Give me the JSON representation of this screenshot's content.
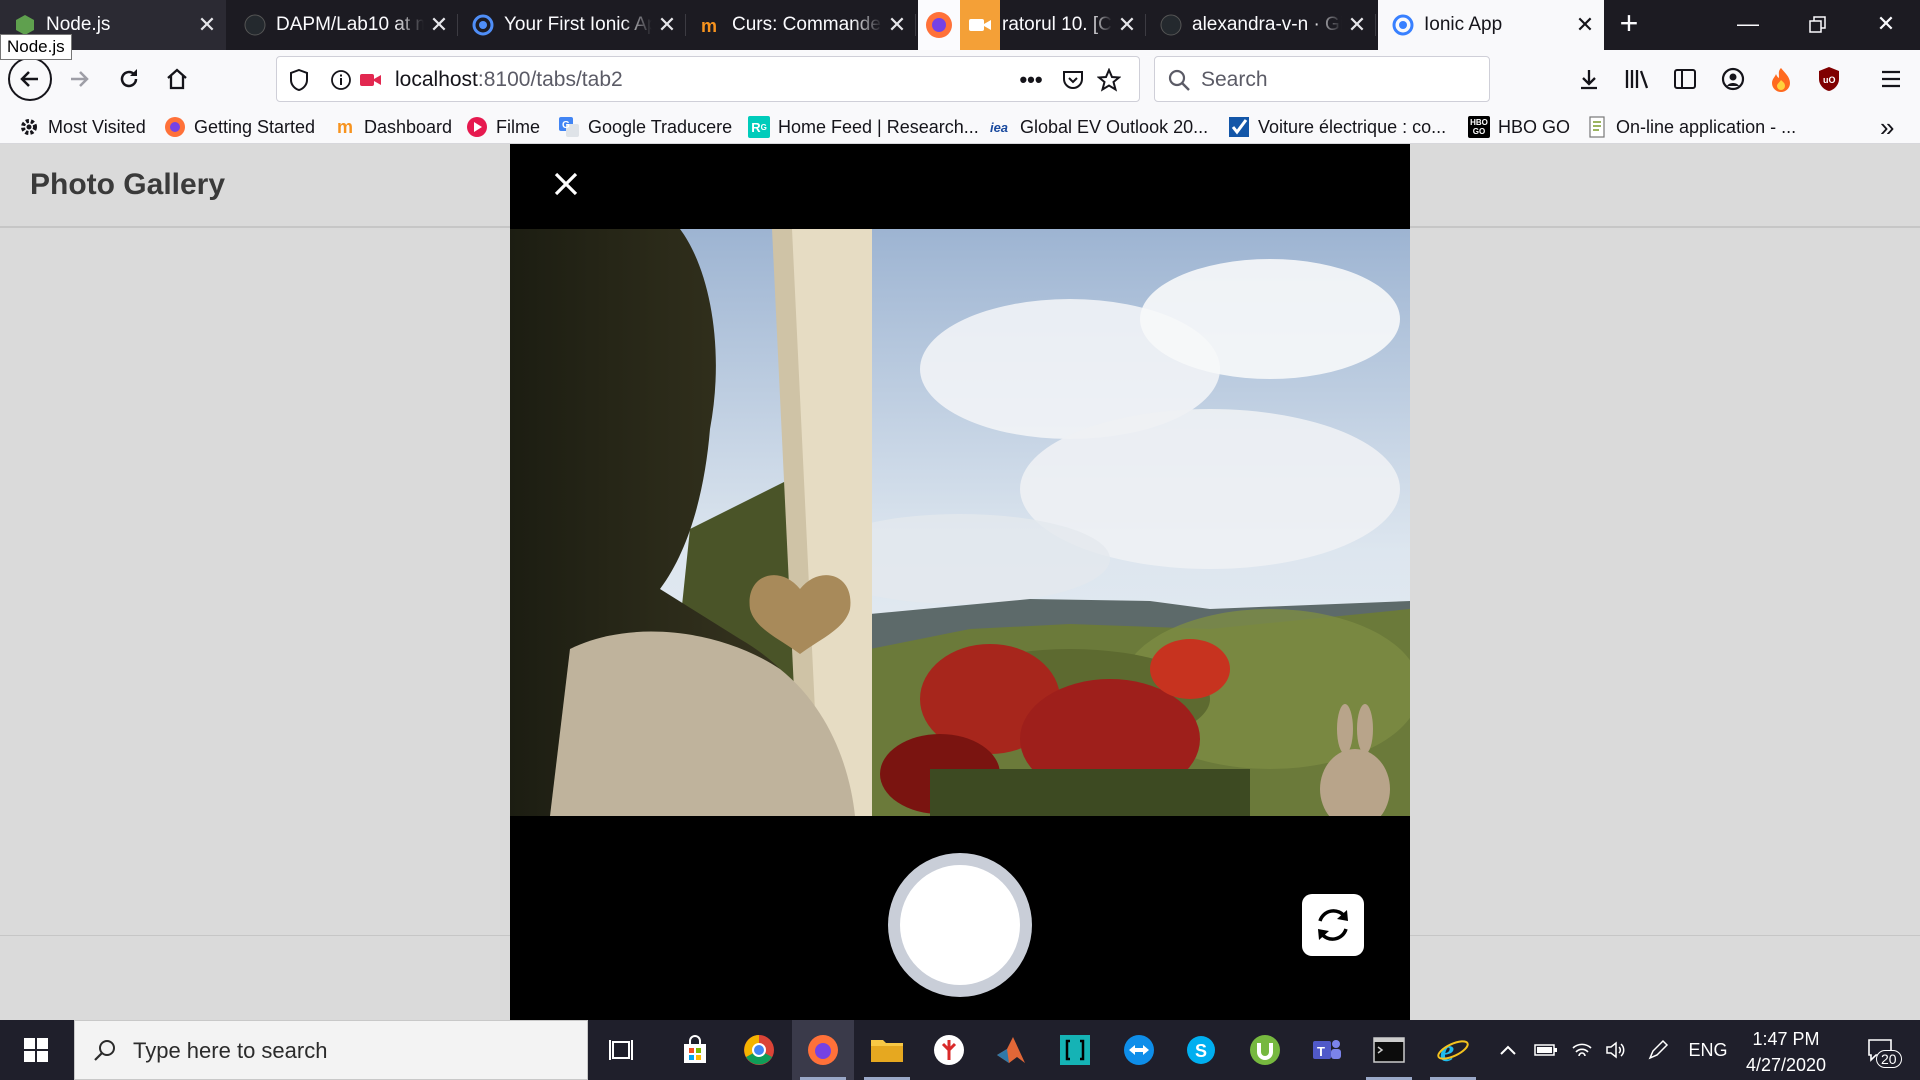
{
  "browser": {
    "tabs": [
      {
        "title": "Node.js",
        "favicon": "nodejs-hex-icon"
      },
      {
        "title": "DAPM/Lab10 at m",
        "favicon": "github-icon"
      },
      {
        "title": "Your First Ionic Ap",
        "favicon": "ionic-icon"
      },
      {
        "title": "Curs: Commande",
        "favicon": "moodle-icon"
      },
      {
        "title": "ratorul 10. [C",
        "favicon": "camera-sharing-icon"
      },
      {
        "title": "alexandra-v-n · Gi",
        "favicon": "github-icon"
      },
      {
        "title": "Ionic App",
        "favicon": "ionic-icon"
      }
    ],
    "active_tab": "Ionic App",
    "tab_tooltip": "Node.js",
    "url_host": "localhost",
    "url_path": ":8100/tabs/tab2",
    "search_placeholder": "Search",
    "bookmarks": [
      {
        "label": "Most Visited",
        "icon": "gear-icon"
      },
      {
        "label": "Getting Started",
        "icon": "firefox-icon"
      },
      {
        "label": "Dashboard",
        "icon": "moodle-icon"
      },
      {
        "label": "Filme",
        "icon": "play-icon"
      },
      {
        "label": "Google Traducere",
        "icon": "translate-icon"
      },
      {
        "label": "Home Feed | Research...",
        "icon": "researchgate-icon"
      },
      {
        "label": "Global EV Outlook 20...",
        "icon": "iea-icon"
      },
      {
        "label": "Voiture électrique : co...",
        "icon": "check-icon"
      },
      {
        "label": "HBO GO",
        "icon": "hbo-icon"
      },
      {
        "label": "On-line application - ...",
        "icon": "document-icon"
      }
    ]
  },
  "app": {
    "title": "Photo Gallery"
  },
  "taskbar": {
    "search_placeholder": "Type here to search",
    "language": "ENG",
    "time": "1:47 PM",
    "date": "4/27/2020",
    "notification_count": "20"
  },
  "colors": {
    "tabstrip_bg": "#1c1b22",
    "active_tab_bg": "#f9f9fb",
    "page_bg": "#dadada",
    "modal_bg": "#000000",
    "shutter_ring": "#c9ced8",
    "taskbar_bg": "#1f1f2b"
  }
}
